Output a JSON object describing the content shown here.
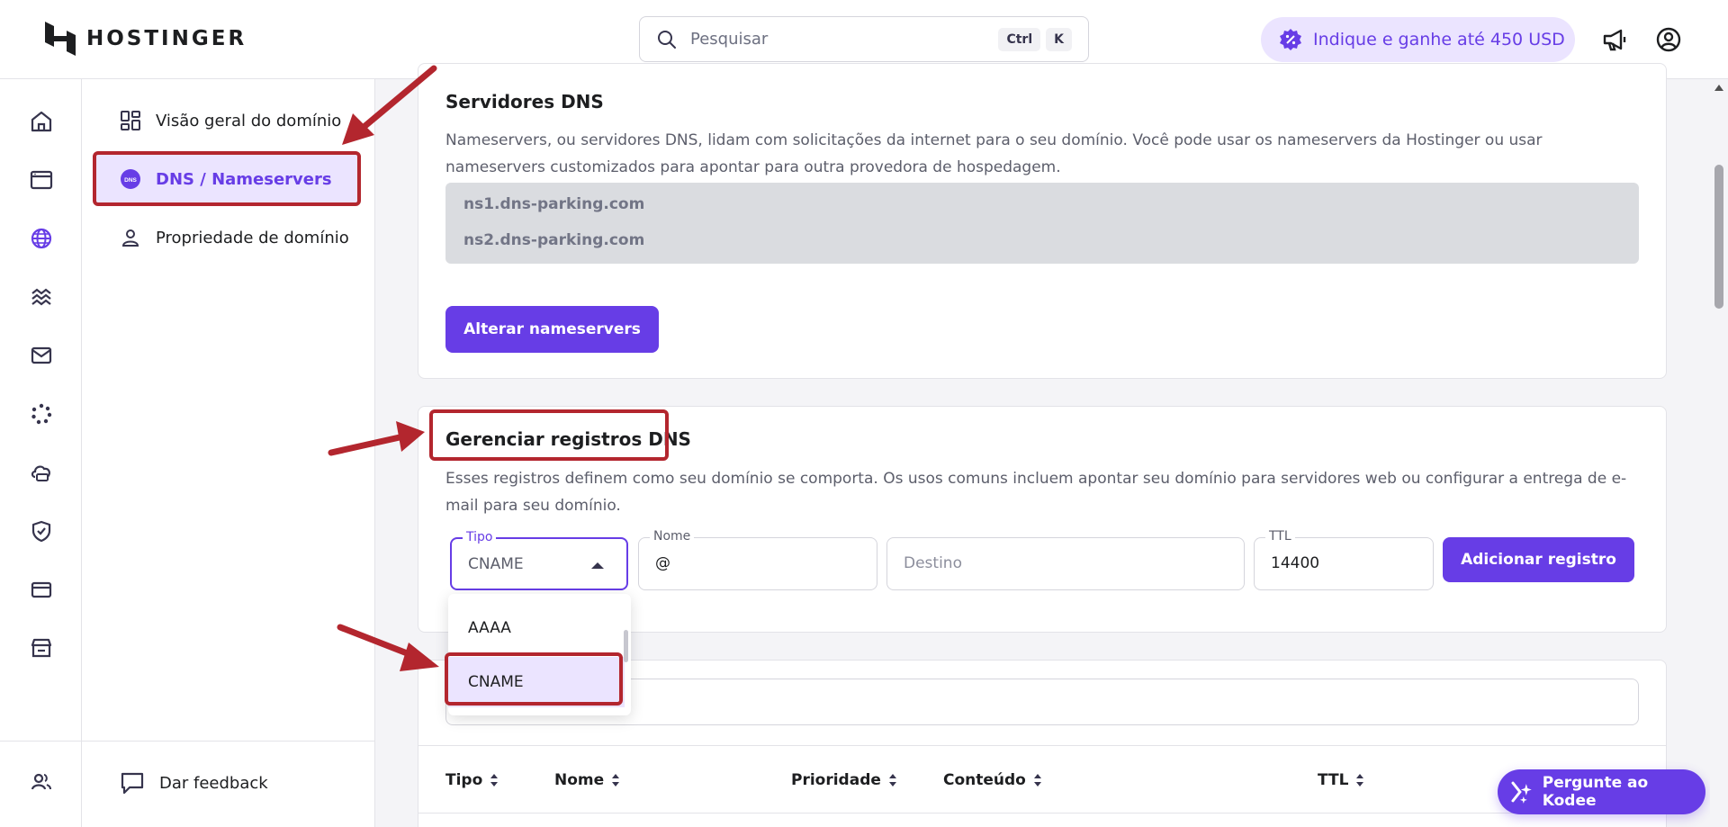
{
  "header": {
    "brand": "HOSTINGER",
    "search_placeholder": "Pesquisar",
    "shortcut_ctrl": "Ctrl",
    "shortcut_k": "K",
    "referral_label": "Indique e ganhe até 450 USD"
  },
  "sidebar": {
    "items": [
      {
        "label": "Visão geral do domínio"
      },
      {
        "label": "DNS / Nameservers",
        "active": true
      },
      {
        "label": "Propriedade de domínio"
      }
    ],
    "feedback_label": "Dar feedback"
  },
  "dns_servers": {
    "title": "Servidores DNS",
    "description": "Nameservers, ou servidores DNS, lidam com solicitações da internet para o seu domínio. Você pode usar os nameservers da Hostinger ou usar nameservers customizados para apontar para outra provedora de hospedagem.",
    "nameservers": [
      "ns1.dns-parking.com",
      "ns2.dns-parking.com"
    ],
    "change_button": "Alterar nameservers"
  },
  "manage_records": {
    "title": "Gerenciar registros DNS",
    "description": "Esses registros definem como seu domínio se comporta. Os usos comuns incluem apontar seu domínio para servidores web ou configurar a entrega de e-mail para seu domínio.",
    "type_label": "Tipo",
    "type_value": "CNAME",
    "name_label": "Nome",
    "name_value": "@",
    "target_placeholder": "Destino",
    "ttl_label": "TTL",
    "ttl_value": "14400",
    "add_button": "Adicionar registro",
    "type_options": [
      "AAAA",
      "CNAME"
    ],
    "selected_option": "CNAME"
  },
  "records_table": {
    "columns": [
      "Tipo",
      "Nome",
      "Prioridade",
      "Conteúdo",
      "TTL"
    ]
  },
  "assistant_button": "Pergunte ao Kodee",
  "colors": {
    "accent": "#673de6",
    "accent_light": "#ebe4ff",
    "annotation": "#b3262e"
  }
}
